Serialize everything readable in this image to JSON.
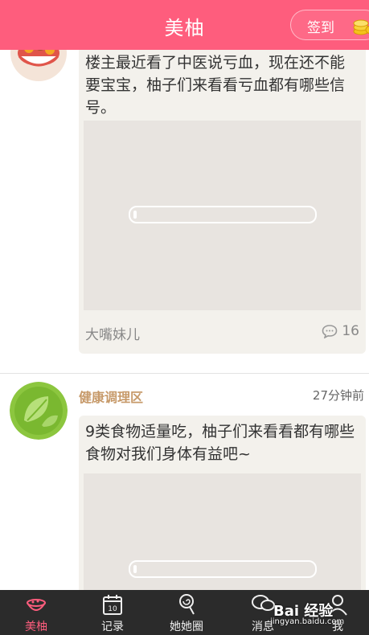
{
  "header": {
    "title": "美柚",
    "checkin_label": "签到"
  },
  "posts": [
    {
      "text": "楼主最近看了中医说亏血，现在还不能要宝宝，柚子们来看看亏血都有哪些信号。",
      "author": "大嘴妹儿",
      "comment_count": "16",
      "image_loading_progress": 0.02
    },
    {
      "category": "健康调理区",
      "time": "27分钟前",
      "text": "9类食物适量吃，柚子们来看看都有哪些食物对我们身体有益吧~",
      "image_loading_progress": 0.02
    }
  ],
  "tabbar": {
    "active": "美柚",
    "tabs": [
      {
        "label": "美柚",
        "icon": "bowl-icon"
      },
      {
        "label": "记录",
        "icon": "calendar-icon"
      },
      {
        "label": "她她圈",
        "icon": "lollipop-icon"
      },
      {
        "label": "消息",
        "icon": "chat-bubbles-icon"
      },
      {
        "label": "我",
        "icon": "person-icon"
      }
    ]
  },
  "watermark": {
    "text": "Bai 经验",
    "sub": "jingyan.baidu.com"
  },
  "colors": {
    "brand": "#fe5d7d",
    "tabbar": "#2b2b2b",
    "category": "#c79a6a",
    "bubble": "#f3f1ec"
  }
}
